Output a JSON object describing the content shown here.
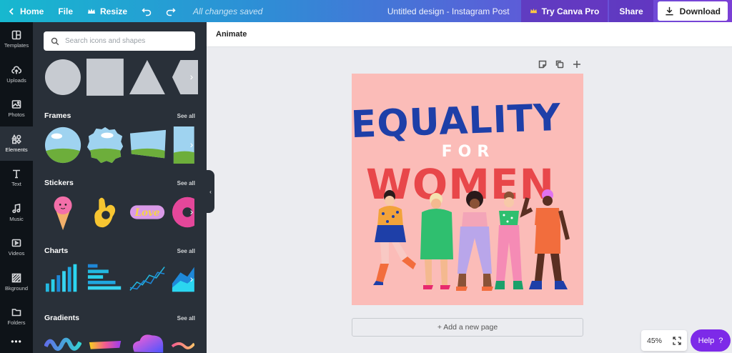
{
  "topbar": {
    "home_label": "Home",
    "file_label": "File",
    "resize_label": "Resize",
    "saved_status": "All changes saved",
    "doc_title": "Untitled design - Instagram Post",
    "try_pro_label": "Try Canva Pro",
    "share_label": "Share",
    "download_label": "Download"
  },
  "rail": {
    "items": [
      {
        "label": "Templates",
        "icon": "templates-icon"
      },
      {
        "label": "Uploads",
        "icon": "upload-cloud-icon"
      },
      {
        "label": "Photos",
        "icon": "photo-icon"
      },
      {
        "label": "Elements",
        "icon": "elements-icon"
      },
      {
        "label": "Text",
        "icon": "text-icon"
      },
      {
        "label": "Music",
        "icon": "music-note-icon"
      },
      {
        "label": "Videos",
        "icon": "video-icon"
      },
      {
        "label": "Bkground",
        "icon": "background-icon"
      },
      {
        "label": "Folders",
        "icon": "folder-icon"
      }
    ]
  },
  "panel": {
    "search_placeholder": "Search icons and shapes",
    "sections": [
      {
        "title": "Frames",
        "see_all": "See all"
      },
      {
        "title": "Stickers",
        "see_all": "See all"
      },
      {
        "title": "Charts",
        "see_all": "See all"
      },
      {
        "title": "Gradients",
        "see_all": "See all"
      }
    ]
  },
  "subbar": {
    "animate_label": "Animate"
  },
  "design": {
    "line1": "EQUALITY",
    "line2": "FOR",
    "line3": "WOMEN"
  },
  "canvas": {
    "add_page_label": "+ Add a new page"
  },
  "zoom": {
    "value": "45%"
  },
  "help": {
    "label": "Help",
    "mark": "?"
  },
  "colors": {
    "brand_purple": "#7d2ae8",
    "design_bg": "#fbbcb8",
    "title_blue": "#1e3fa8",
    "title_red": "#e8474a"
  }
}
